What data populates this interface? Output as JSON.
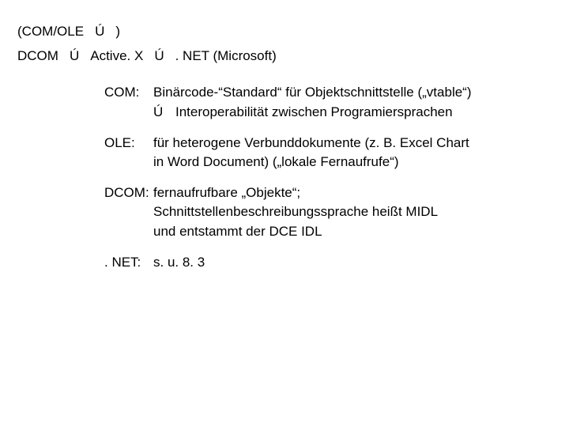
{
  "line1": {
    "a": "(COM/OLE",
    "arrow": "Ú",
    "b": ")"
  },
  "line2": {
    "a": "DCOM",
    "arrow1": "Ú",
    "b": "Active. X",
    "arrow2": "Ú",
    "c": ". NET  (Microsoft)"
  },
  "defs": {
    "com": {
      "key": "COM:",
      "val": "Binärcode-“Standard“ für Objektschnittstelle („vtable“)",
      "subArrow": "Ú",
      "subText": "Interoperabilität zwischen Programiersprachen"
    },
    "ole": {
      "key": "OLE:",
      "val1": "für heterogene Verbunddokumente (z. B. Excel Chart",
      "val2": "in Word Document) („lokale Fernaufrufe“)"
    },
    "dcom": {
      "key": "DCOM:",
      "val1": "fernaufrufbare „Objekte“;",
      "val2": "Schnittstellenbeschreibungssprache heißt MIDL",
      "val3": "und entstammt der DCE IDL"
    },
    "net": {
      "key": ". NET:",
      "val": "s. u.  8. 3"
    }
  }
}
